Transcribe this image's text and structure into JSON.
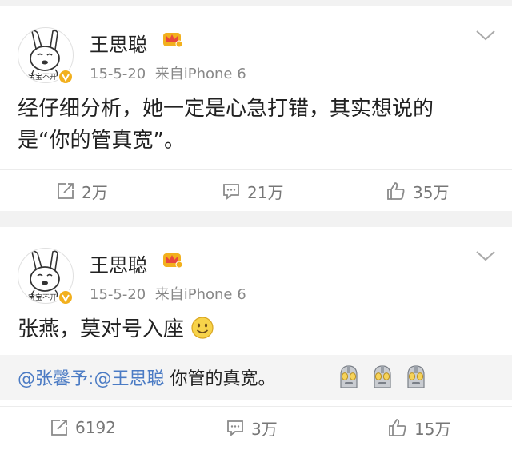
{
  "posts": [
    {
      "author": "王思聪",
      "time": "15-5-20",
      "source": "来自iPhone 6",
      "avatar_caption": "宝宝不开",
      "content_lines": [
        "经仔细分析，她一定是心急打错，其实想说的",
        "是“你的管真宽”。"
      ],
      "actions": {
        "repost": "2万",
        "comment": "21万",
        "like": "35万"
      }
    },
    {
      "author": "王思聪",
      "time": "15-5-20",
      "source": "来自iPhone 6",
      "avatar_caption": "宝宝不开",
      "content_lines": [
        "张燕，莫对号入座"
      ],
      "repost": {
        "user1": "@张馨予",
        "sep": ":",
        "user2": "@王思聪",
        "content": " 你管的真宽。"
      },
      "actions": {
        "repost": "6192",
        "comment": "3万",
        "like": "15万"
      }
    }
  ],
  "colors": {
    "link": "#4b7bc4",
    "vip_gold": "#f2b01e",
    "vip_red": "#e8483d",
    "icon": "#8a8a8a"
  }
}
